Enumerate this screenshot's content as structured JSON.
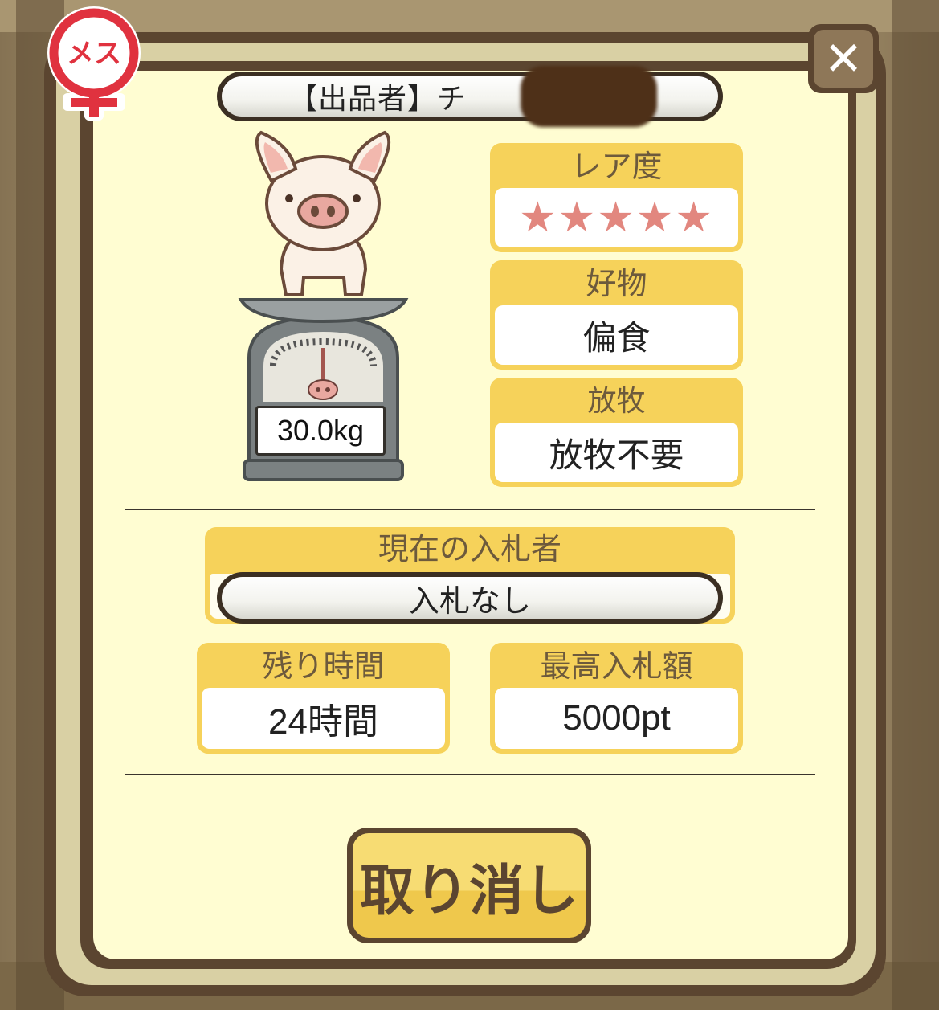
{
  "seller": {
    "label": "【出品者】チ"
  },
  "gender": {
    "label": "メス"
  },
  "pig": {
    "weight": "30.0kg"
  },
  "rarity": {
    "title": "レア度",
    "stars": "★★★★★",
    "value": 5
  },
  "favorite": {
    "title": "好物",
    "value": "偏食"
  },
  "grazing": {
    "title": "放牧",
    "value": "放牧不要"
  },
  "bidder": {
    "title": "現在の入札者",
    "value": "入札なし"
  },
  "time_left": {
    "title": "残り時間",
    "value": "24時間"
  },
  "max_bid": {
    "title": "最高入札額",
    "value": "5000pt"
  },
  "actions": {
    "cancel_label": "取り消し"
  },
  "colors": {
    "frame": "#5b4530",
    "panel": "#fffdd2",
    "card_header": "#f6d25a",
    "star": "#e2877f",
    "gender": "#e0323f"
  },
  "icons": {
    "close": "close-icon",
    "gender": "female-icon"
  }
}
